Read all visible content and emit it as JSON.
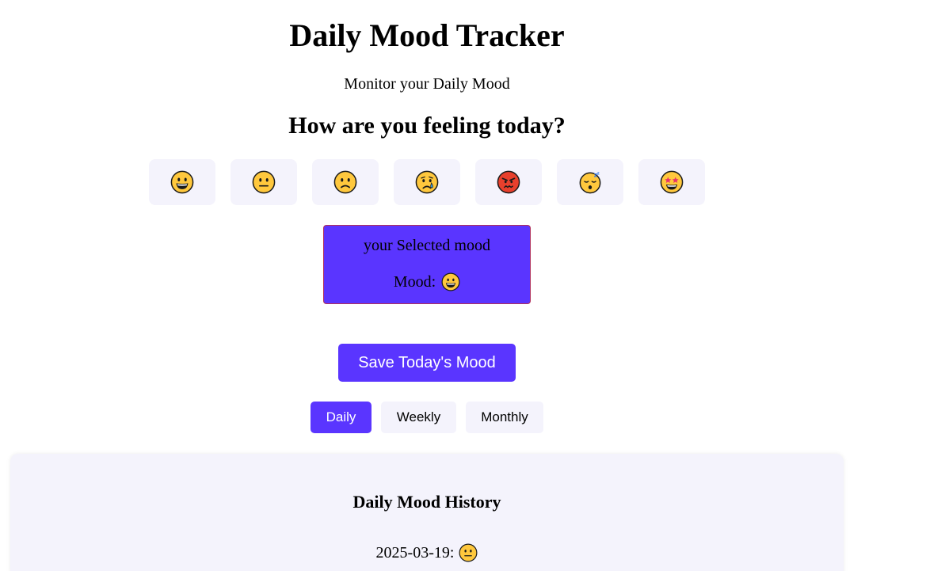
{
  "header": {
    "title": "Daily Mood Tracker",
    "subtitle": "Monitor your Daily Mood",
    "question": "How are you feeling today?"
  },
  "moods": [
    {
      "name": "happy",
      "emoji": "😀"
    },
    {
      "name": "neutral",
      "emoji": "😐"
    },
    {
      "name": "sad",
      "emoji": "🙁"
    },
    {
      "name": "crying",
      "emoji": "😢"
    },
    {
      "name": "angry",
      "emoji": "😡"
    },
    {
      "name": "sleepy",
      "emoji": "😴"
    },
    {
      "name": "star-struck",
      "emoji": "🤩"
    }
  ],
  "selected": {
    "title": "your Selected mood",
    "label": "Mood:",
    "emoji": "😀"
  },
  "actions": {
    "save_label": "Save Today's Mood"
  },
  "tabs": [
    {
      "label": "Daily",
      "active": true
    },
    {
      "label": "Weekly",
      "active": false
    },
    {
      "label": "Monthly",
      "active": false
    }
  ],
  "history": {
    "title": "Daily Mood History",
    "entries": [
      {
        "date": "2025-03-19:",
        "emoji": "😐"
      }
    ]
  },
  "colors": {
    "accent": "#5a35ff",
    "button_bg": "#f4f3fc",
    "face_yellow": "#ffc83d",
    "angry_red": "#e8402d"
  }
}
